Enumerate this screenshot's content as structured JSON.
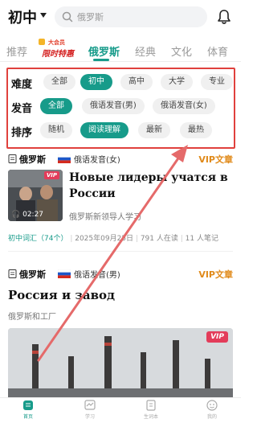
{
  "header": {
    "level": "初中",
    "search_placeholder": "俄罗斯"
  },
  "tabs": [
    {
      "label": "推荐",
      "active": false
    },
    {
      "label": "俄罗斯",
      "active": true
    },
    {
      "label": "经典",
      "active": false
    },
    {
      "label": "文化",
      "active": false
    },
    {
      "label": "体育",
      "active": false
    }
  ],
  "promo": {
    "top": "大会员",
    "bottom": "限时特惠"
  },
  "filters": {
    "difficulty": {
      "label": "难度",
      "options": [
        "全部",
        "初中",
        "高中",
        "大学",
        "专业"
      ],
      "selected": "初中"
    },
    "voice": {
      "label": "发音",
      "options": [
        "全部",
        "俄语发音(男)",
        "俄语发音(女)"
      ],
      "selected": "全部"
    },
    "sort": {
      "label": "排序",
      "options": [
        "随机",
        "阅读理解",
        "最新",
        "最热"
      ],
      "selected": "阅读理解"
    }
  },
  "articles": [
    {
      "category": "俄罗斯",
      "voice": "俄语发音(女)",
      "vip_label": "VIP文章",
      "thumb_badge": "VIP",
      "duration": "02:27",
      "title": "Новые лидеры учатся в России",
      "subtitle": "俄罗斯新领导人学习",
      "meta": {
        "vocab": "初中词汇（74个）",
        "date": "2025年09月25日",
        "read": "791 人在读",
        "notes": "11 人笔记"
      }
    },
    {
      "category": "俄罗斯",
      "voice": "俄语发音(男)",
      "vip_label": "VIP文章",
      "thumb_badge": "VIP",
      "title": "Россия и завод",
      "subtitle": "俄罗斯和工厂"
    }
  ],
  "bottom_nav": [
    {
      "label": "首页",
      "icon": "home-icon",
      "active": true
    },
    {
      "label": "学习",
      "icon": "study-icon",
      "active": false
    },
    {
      "label": "生词本",
      "icon": "wordbook-icon",
      "active": false
    },
    {
      "label": "我的",
      "icon": "profile-icon",
      "active": false
    }
  ],
  "colors": {
    "accent": "#179b8a",
    "vip": "#e08a1a",
    "highlight": "#e0413d"
  }
}
